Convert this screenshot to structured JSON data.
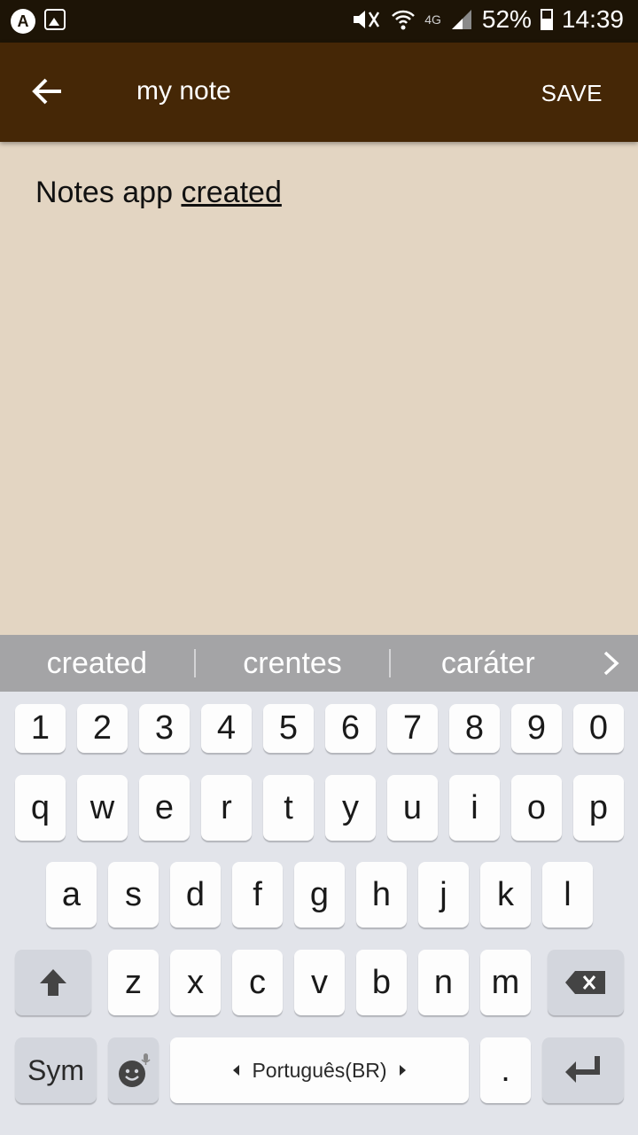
{
  "status_bar": {
    "app_icon": "A",
    "network": "4G",
    "battery": "52%",
    "time": "14:39"
  },
  "toolbar": {
    "title": "my note",
    "save_label": "SAVE",
    "back_icon": "arrow-left-icon"
  },
  "note": {
    "text_before": "Notes app ",
    "text_underlined": "created"
  },
  "suggestions": [
    "created",
    "crentes",
    "caráter"
  ],
  "keyboard": {
    "row_numbers": [
      "1",
      "2",
      "3",
      "4",
      "5",
      "6",
      "7",
      "8",
      "9",
      "0"
    ],
    "row_qwerty": [
      "q",
      "w",
      "e",
      "r",
      "t",
      "y",
      "u",
      "i",
      "o",
      "p"
    ],
    "row_asdf": [
      "a",
      "s",
      "d",
      "f",
      "g",
      "h",
      "j",
      "k",
      "l"
    ],
    "row_zxcv": [
      "z",
      "x",
      "c",
      "v",
      "b",
      "n",
      "m"
    ],
    "sym_label": "Sym",
    "space_language": "Português(BR)",
    "period_label": "."
  }
}
